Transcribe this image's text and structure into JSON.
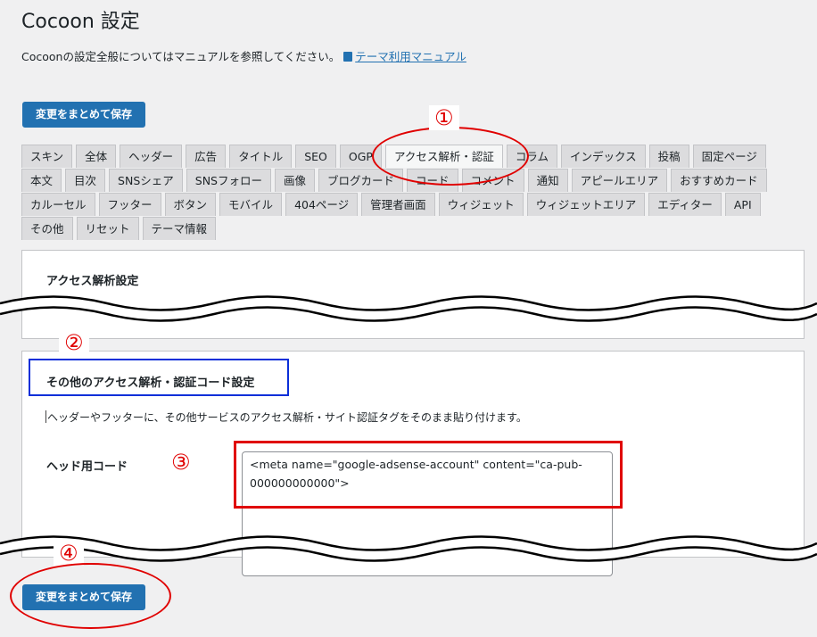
{
  "page": {
    "title": "Cocoon 設定",
    "intro_text": "Cocoonの設定全般についてはマニュアルを参照してください。",
    "manual_link": "テーマ利用マニュアル"
  },
  "save_button_label": "変更をまとめて保存",
  "tabs": {
    "row1": [
      "スキン",
      "全体",
      "ヘッダー",
      "広告",
      "タイトル",
      "SEO",
      "OGP",
      "アクセス解析・認証",
      "コラム",
      "インデックス",
      "投稿",
      "固定ページ"
    ],
    "row2": [
      "本文",
      "目次",
      "SNSシェア",
      "SNSフォロー",
      "画像",
      "ブログカード",
      "コード",
      "コメント",
      "通知",
      "アピールエリア",
      "おすすめカード"
    ],
    "row3": [
      "カルーセル",
      "フッター",
      "ボタン",
      "モバイル",
      "404ページ",
      "管理者画面",
      "ウィジェット",
      "ウィジェットエリア",
      "エディター",
      "API"
    ],
    "row4": [
      "その他",
      "リセット",
      "テーマ情報"
    ],
    "active": "アクセス解析・認証"
  },
  "panel1": {
    "heading": "アクセス解析設定"
  },
  "panel2": {
    "heading": "その他のアクセス解析・認証コード設定",
    "description": "ヘッダーやフッターに、その他サービスのアクセス解析・サイト認証タグをそのまま貼り付けます。",
    "head_code_label": "ヘッド用コード",
    "head_code_value": "<meta name=\"google-adsense-account\" content=\"ca-pub-000000000000\">"
  },
  "annotations": {
    "n1": "①",
    "n2": "②",
    "n3": "③",
    "n4": "④",
    "red_color": "#e00000",
    "blue_color": "#0b2fd9"
  }
}
